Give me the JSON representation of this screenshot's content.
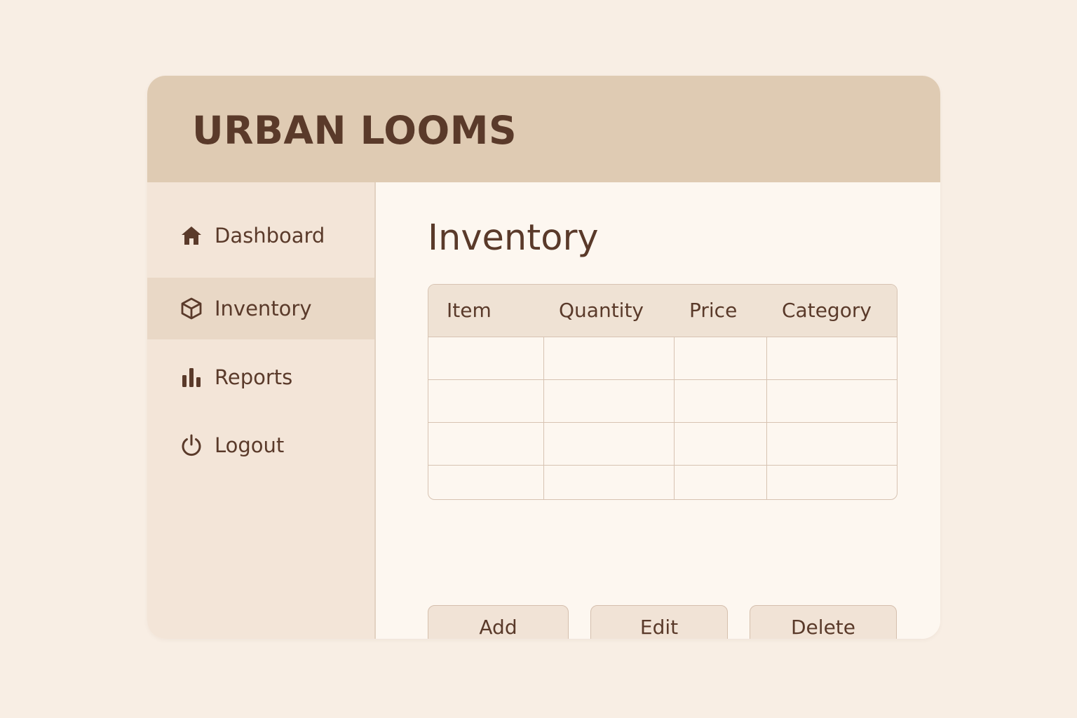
{
  "app": {
    "brand": "URBAN LOOMS"
  },
  "sidebar": {
    "items": [
      {
        "label": "Dashboard",
        "icon": "home-icon",
        "active": false
      },
      {
        "label": "Inventory",
        "icon": "box-icon",
        "active": true
      },
      {
        "label": "Reports",
        "icon": "bar-chart-icon",
        "active": false
      },
      {
        "label": "Logout",
        "icon": "power-icon",
        "active": false
      }
    ]
  },
  "main": {
    "title": "Inventory",
    "table": {
      "columns": [
        "Item",
        "Quantity",
        "Price",
        "Category"
      ],
      "rows": [
        [
          "",
          "",
          "",
          ""
        ],
        [
          "",
          "",
          "",
          ""
        ],
        [
          "",
          "",
          "",
          ""
        ],
        [
          "",
          "",
          "",
          ""
        ]
      ]
    },
    "actions": {
      "add_label": "Add",
      "edit_label": "Edit",
      "delete_label": "Delete"
    }
  },
  "colors": {
    "page_background": "#f8eee4",
    "header_background": "#dfcbb3",
    "sidebar_background": "#f3e5d8",
    "active_item_background": "#e9d8c6",
    "content_background": "#fdf7f0",
    "text": "#5a3a2a",
    "border": "#d7c3b2"
  }
}
